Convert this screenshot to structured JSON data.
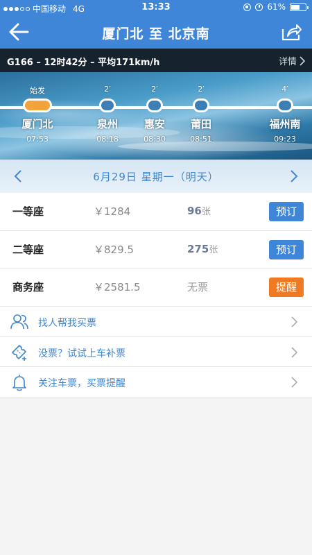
{
  "status_bar": {
    "carrier": "中国移动",
    "network": "4G",
    "time": "13:33",
    "battery": "61%",
    "battery_level": 0.61
  },
  "nav": {
    "title": "厦门北 至 北京南",
    "back_icon": "back-arrow-icon",
    "share_icon": "share-icon"
  },
  "train_info": {
    "summary": "G166 – 12时42分 – 平均171km/h",
    "detail_label": "详情"
  },
  "route": {
    "stations": [
      {
        "stop": "始发",
        "name": "厦门北",
        "time": "07:53",
        "is_start": true
      },
      {
        "stop": "2′",
        "name": "泉州",
        "time": "08:18",
        "is_start": false
      },
      {
        "stop": "2′",
        "name": "惠安",
        "time": "08:30",
        "is_start": false
      },
      {
        "stop": "2′",
        "name": "莆田",
        "time": "08:51",
        "is_start": false
      },
      {
        "stop": "4′",
        "name": "福州南",
        "time": "09:23",
        "is_start": false
      }
    ],
    "colors": {
      "start_node": "#f2a33a",
      "track": "#ffffff"
    }
  },
  "date_bar": {
    "label": "6月29日 星期一（明天）"
  },
  "seats": [
    {
      "name": "一等座",
      "price": "￥1284",
      "count": "96",
      "unit": "张",
      "button": "预订",
      "button_style": "blue"
    },
    {
      "name": "二等座",
      "price": "￥829.5",
      "count": "275",
      "unit": "张",
      "button": "预订",
      "button_style": "blue"
    },
    {
      "name": "商务座",
      "price": "￥2581.5",
      "count": "无票",
      "unit": "",
      "button": "提醒",
      "button_style": "orange"
    }
  ],
  "actions": [
    {
      "label": "找人帮我买票",
      "icon": "people-icon"
    },
    {
      "label": "没票？试试上车补票",
      "icon": "ticket-icon"
    },
    {
      "label": "关注车票，买票提醒",
      "icon": "bell-icon"
    }
  ],
  "colors": {
    "accent": "#3f86d8",
    "orange": "#ef7a22",
    "dark_bar": "#16232f"
  }
}
